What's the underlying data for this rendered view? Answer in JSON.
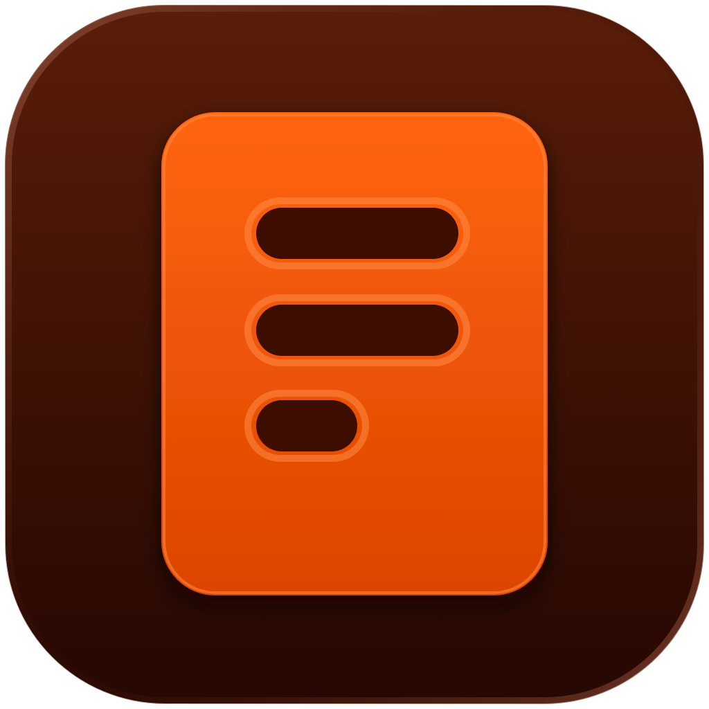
{
  "icon": {
    "name": "document-lines-app-icon",
    "glyph": "document-with-three-lines",
    "line_count": 3
  },
  "colors": {
    "tile_top": "#5a1d08",
    "tile_bottom": "#260702",
    "tile_rim": "#8a4a35",
    "sheet_top": "#ff6510",
    "sheet_bottom": "#dc4500",
    "sheet_highlight": "#ff8a4a",
    "slot_fill": "#3c1004",
    "slot_rim": "#ff8a45"
  }
}
